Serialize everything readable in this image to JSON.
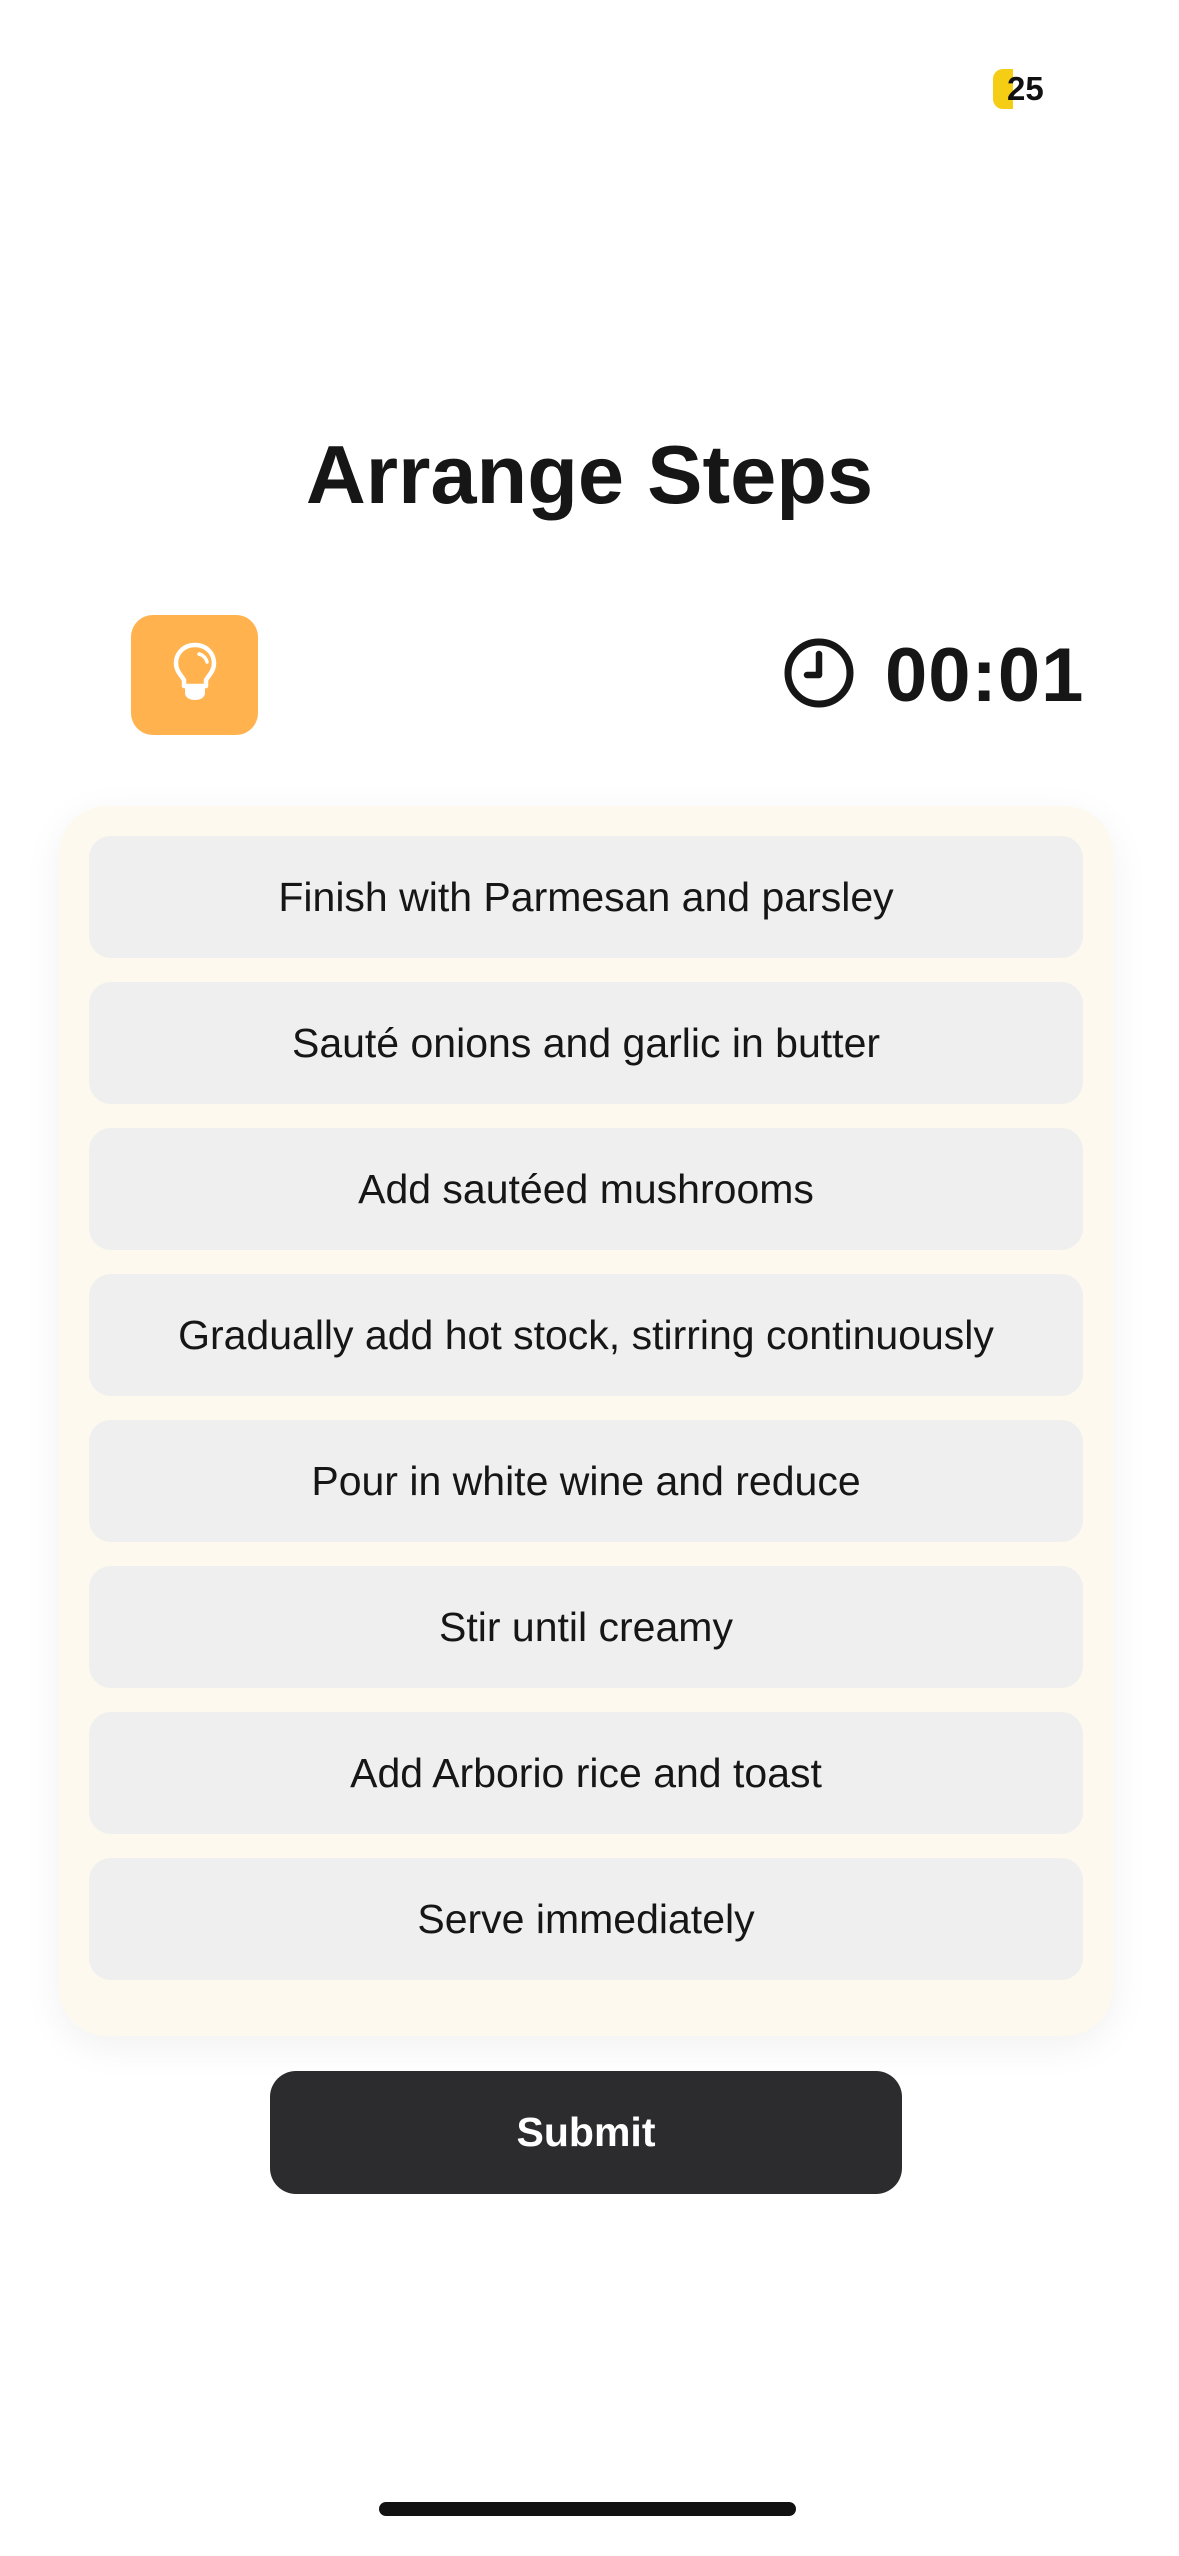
{
  "header": {
    "coin_count": "25",
    "coin_color": "#f6cd15"
  },
  "title": "Arrange Steps",
  "hint": {
    "icon": "lightbulb-icon",
    "color": "#ffb24d"
  },
  "timer": {
    "icon": "clock-icon",
    "value": "00:01"
  },
  "steps": [
    {
      "label": "Finish with Parmesan and parsley"
    },
    {
      "label": "Sauté onions and garlic in butter"
    },
    {
      "label": "Add sautéed mushrooms"
    },
    {
      "label": "Gradually add hot stock, stirring continuously"
    },
    {
      "label": "Pour in white wine and reduce"
    },
    {
      "label": "Stir until creamy"
    },
    {
      "label": "Add Arborio rice and toast"
    },
    {
      "label": "Serve immediately"
    }
  ],
  "submit_label": "Submit"
}
